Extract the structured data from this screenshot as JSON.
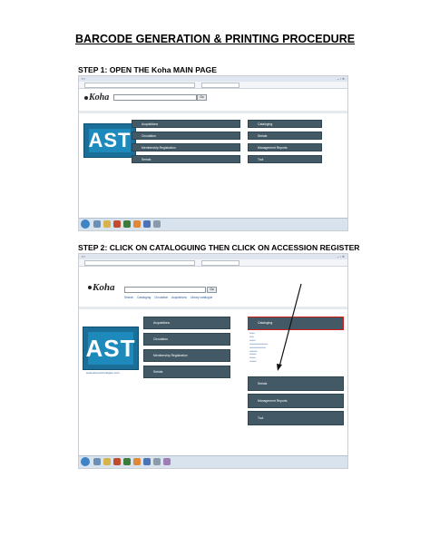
{
  "document": {
    "title": "BARCODE GENERATION & PRINTING PROCEDURE",
    "step1_heading": "STEP 1: OPEN THE Koha MAIN PAGE",
    "step2_heading": "STEP 2: CLICK ON CATALOGUING THEN CLICK ON ACCESSION REGISTER"
  },
  "koha": {
    "logo_text": "Koha",
    "search_go": "Go",
    "ast_letters": "AST",
    "ast_website": "www.ast-technologies.com",
    "left_modules": [
      "Acquisitions",
      "Circulation",
      "Membership Registration",
      "Serials"
    ],
    "right_modules": [
      "Cataloging",
      "Serials",
      "Management Reports",
      "Tool"
    ],
    "step2_tabs": [
      "Search",
      "Cataloging",
      "Circulation",
      "Acquisitions",
      "Library catalogue"
    ]
  },
  "colors": {
    "module_button": "#435a66",
    "highlight_border": "#d01b1b",
    "taskbar": "#d9e3ee",
    "ast_logo_blue": "#1e89bb"
  }
}
